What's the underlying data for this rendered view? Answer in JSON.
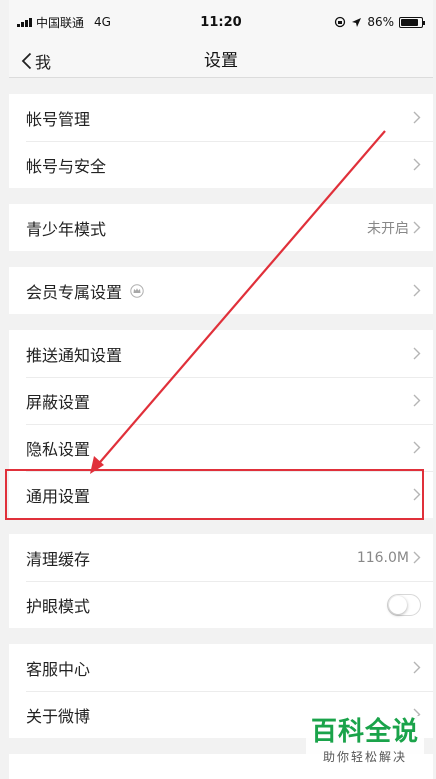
{
  "status_bar": {
    "carrier": "中国联通",
    "network": "4G",
    "time": "11:20",
    "battery": "86%",
    "battery_level": 0.86
  },
  "nav": {
    "back_label": "我",
    "title": "设置"
  },
  "groups": {
    "account": {
      "account_manage": "帐号管理",
      "account_security": "帐号与安全"
    },
    "youth": {
      "youth_mode": "青少年模式",
      "youth_mode_value": "未开启"
    },
    "vip": {
      "vip_settings": "会员专属设置"
    },
    "general": {
      "push_settings": "推送通知设置",
      "block_settings": "屏蔽设置",
      "privacy_settings": "隐私设置",
      "general_settings": "通用设置"
    },
    "storage": {
      "clear_cache": "清理缓存",
      "cache_size": "116.0M",
      "eye_mode": "护眼模式",
      "eye_mode_on": false
    },
    "help": {
      "customer_service": "客服中心",
      "about": "关于微博"
    }
  },
  "watermark": {
    "title": "百科全说",
    "subtitle": "助你轻松解决"
  },
  "colors": {
    "annotation_red": "#e0303a",
    "watermark_green": "#1aa34a"
  }
}
